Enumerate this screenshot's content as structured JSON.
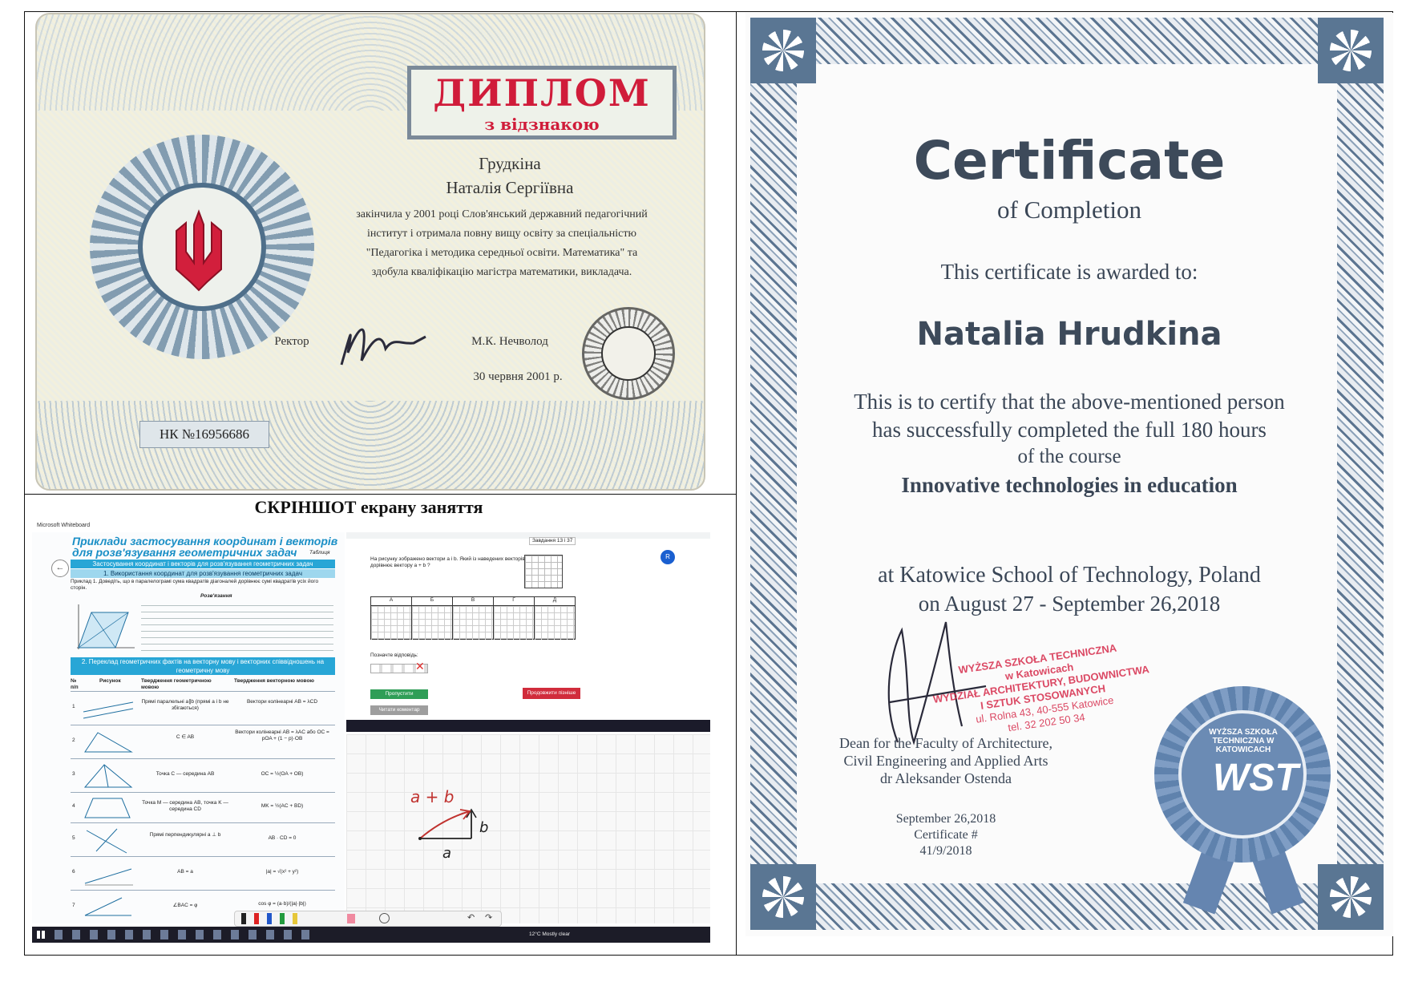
{
  "diploma": {
    "title": "ДИПЛОМ",
    "subtitle": "з відзнакою",
    "surname": "Грудкіна",
    "name": "Наталія Сергіївна",
    "text_lines": [
      "закінчила у 2001 році Слов'янський державний педагогічний",
      "інститут і отримала повну вищу освіту за спеціальністю",
      "\"Педагогіка і методика середньої освіти. Математика\" та",
      "здобула кваліфікацію магістра математики, викладача."
    ],
    "rector_label": "Ректор",
    "rector_name": "М.К. Нечволод",
    "date": "30 червня 2001 р.",
    "number": "НК №16956686"
  },
  "screenshot": {
    "caption": "СКРІНШОТ  екрану заняття",
    "app_title": "Microsoft Whiteboard",
    "book_title_1": "Приклади застосування координат і векторів",
    "book_title_2": "для розв'язування геометричних задач",
    "table_label": "Таблиця",
    "header_1": "Застосування координат і векторів для розв'язування геометричних задач",
    "header_2": "1. Використання координат для розв'язування геометричних задач",
    "example_text": "Приклад 1. Доведіть, що в паралелограмі сума квадратів діагоналей дорівнює сумі квадратів усіх його сторін.",
    "solution_label": "Розв'язання",
    "header_3": "2. Переклад геометричних фактів на векторну мову і векторних співвідношень на геометричну мову",
    "col_headers": [
      "№ п/п",
      "Рисунок",
      "Твердження геометричною мовою",
      "Твердження векторною мовою"
    ],
    "rows": [
      {
        "n": "1",
        "geo": "Прямі паралельні a∥b (прямі a і b не збігаються)",
        "vec": "Вектори колінеарні AB = λCD"
      },
      {
        "n": "2",
        "geo": "C ∈ AB",
        "vec": "Вектори колінеарні AB = λAC або OC = pOA + (1 − p)·OB"
      },
      {
        "n": "3",
        "geo": "Точка C — середина AB",
        "vec": "OC = ½(OA + OB)"
      },
      {
        "n": "4",
        "geo": "Точка M — середина AB, точка K — середина CD",
        "vec": "MK = ½(AC + BD)"
      },
      {
        "n": "5",
        "geo": "Прямі перпендикулярні a ⊥ b",
        "vec": "AB · CD = 0"
      },
      {
        "n": "6",
        "geo": "AB = a",
        "vec": "|a| = √(x² + y²)"
      },
      {
        "n": "7",
        "geo": "∠BAC = φ",
        "vec": "cos φ = (a·b)/(|a|·|b|)"
      }
    ],
    "task_label": "Завдання 13 і 37",
    "task_question": "На рисунку зображено вектори a і b. Який із наведених векторів дорівнює вектору a + b ?",
    "answer_options": [
      "А",
      "Б",
      "В",
      "Г",
      "Д"
    ],
    "answer_prompt": "Позначте відповідь:",
    "btn_skip": "Пропустити",
    "btn_later": "Продовжити пізніше",
    "btn_comment": "Читати коментар",
    "whiteboard_label_sum": "a + b",
    "whiteboard_label_a": "a",
    "whiteboard_label_b": "b",
    "weather": "12°C  Mostly clear"
  },
  "certificate": {
    "title": "Certificate",
    "subtitle": "of Completion",
    "awarded": "This certificate is awarded to:",
    "recipient": "Natalia Hrudkina",
    "line1": "This is to certify that the above-mentioned person",
    "line2": "has successfully completed the full 180 hours",
    "line3": "of the course",
    "course": "Innovative technologies in education",
    "school": "at Katowice School of Technology, Poland",
    "dates": "on August 27 - September 26,2018",
    "stamp_lines": [
      "WYŻSZA SZKOŁA TECHNICZNA",
      "w Katowicach",
      "WYDZIAŁ ARCHITEKTURY, BUDOWNICTWA",
      "I SZTUK STOSOWANYCH",
      "ul. Rolna 43, 40-555 Katowice",
      "tel. 32 202 50 34"
    ],
    "dean_lines": [
      "Dean for the Faculty of Architecture,",
      "Civil Engineering and Applied Arts",
      "dr Aleksander Ostenda"
    ],
    "issue_date": "September 26,2018",
    "cert_no_label": "Certificate #",
    "cert_no": "41/9/2018",
    "seal_text": "WYŻSZA SZKOŁA TECHNICZNA W KATOWICACH",
    "seal_logo": "WST"
  }
}
